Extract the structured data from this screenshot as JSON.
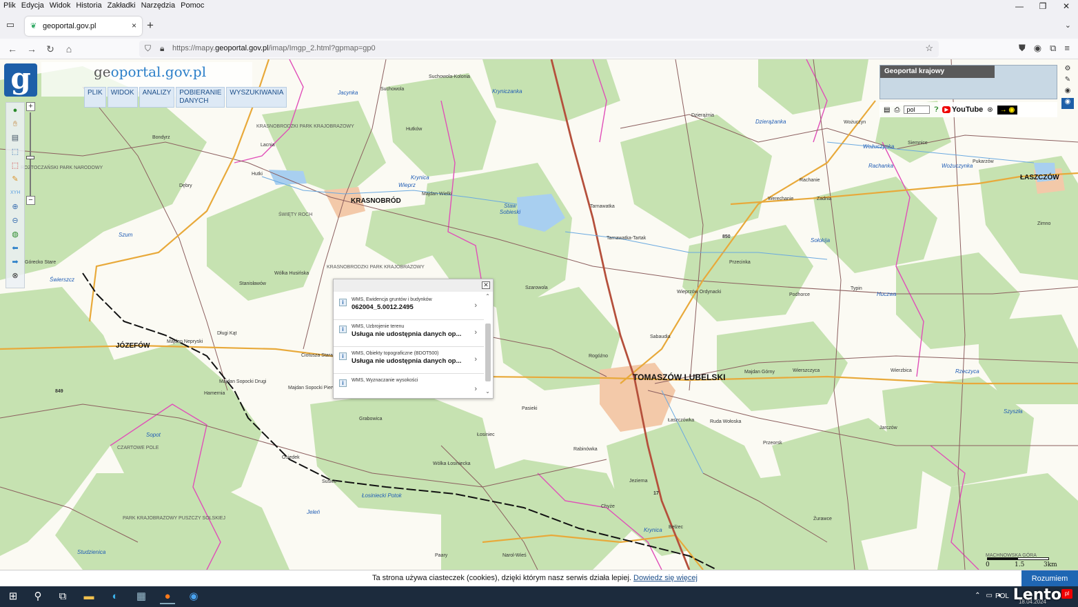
{
  "menubar": {
    "items": [
      "Plik",
      "Edycja",
      "Widok",
      "Historia",
      "Zakładki",
      "Narzędzia",
      "Pomoc"
    ]
  },
  "window_controls": {
    "minimize": "—",
    "restore": "❐",
    "close": "✕"
  },
  "tab": {
    "title": "geoportal.gov.pl",
    "close": "×",
    "new_tab": "+"
  },
  "navbar": {
    "url_prefix": "https://mapy.",
    "url_domain": "geoportal.gov.pl",
    "url_path": "/imap/Imgp_2.html?gpmap=gp0"
  },
  "geoportal": {
    "logo_letter": "g",
    "title_g": "ge",
    "title_rest": "oportal.gov.pl",
    "menu": [
      "PLIK",
      "WIDOK",
      "ANALIZY",
      "POBIERANIE DANYCH",
      "WYSZUKIWANIA"
    ],
    "overview_title": "Geoportal krajowy",
    "lang_select": "pol",
    "youtube_label": "YouTube"
  },
  "map_labels": {
    "bigtowns": [
      "TOMASZÓW LUBELSKI"
    ],
    "towns": [
      "KRASNOBRÓD",
      "JÓZEFÓW",
      "ŁASZCZÓW"
    ],
    "places": [
      "Suchowola",
      "Suchowola-Kolonia",
      "Bondyrz",
      "Hutków",
      "Hutki",
      "Majdan Wielki",
      "Tarnawatka",
      "Tarnawatka-Tartak",
      "Szarowola",
      "Stanisławów",
      "Wólka Husińska",
      "Długi Kąt",
      "Ciotusza Stara",
      "Majdan Nepryski",
      "Majdan Sopocki Drugi",
      "Majdan Sopocki Pierwszy",
      "Hamernia",
      "Górecko Stare",
      "Pasieki",
      "Rogóźno",
      "Sabaudia",
      "Wieprzów Ordynacki",
      "Przecinka",
      "Majdan Górny",
      "Łaszczówka",
      "Ruda Wołoska",
      "Przeorsk",
      "Typin",
      "Podhorce",
      "Jarczów",
      "Rabinówka",
      "Łosiniec",
      "Wólka Łosiniecka",
      "Grabowica",
      "Osiedek",
      "Susiec",
      "Jezierna",
      "Bełżec",
      "Chyże",
      "Narol-Wieś",
      "Paary",
      "Żurawce",
      "Wierzbica",
      "Rachanie",
      "Werechanie",
      "Zadnia",
      "Dzierążnia",
      "Wożuczyn",
      "Siemnice",
      "Pukarzów",
      "Zimno",
      "Wierszczyca",
      "Lacnia",
      "Dębry"
    ],
    "rivers": [
      "Jacynka",
      "Wieprz",
      "Krynica",
      "Szum",
      "Świerszcz",
      "Sopot",
      "Jeleń",
      "Łosiniecki Potok",
      "Studzienica",
      "Kryniczanka",
      "Dzierążanka",
      "Wożuczynka",
      "Rachanka",
      "Wożuczynka",
      "Sołokija",
      "Huczwa",
      "Rzeczyca",
      "Szyszła",
      "Krynica"
    ],
    "lake": "Staw Sobieski",
    "areas": [
      "KRASNOBRODZKI PARK KRAJOBRAZOWY",
      "KRASNOBRODZKI PARK KRAJOBRAZOWY",
      "PARK KRAJOBRAZOWY PUSZCZY SOLSKIEJ",
      "ROZTOCZAŃSKI PARK NARODOWY",
      "ŚWIĘTY ROCH",
      "CZARTOWE POLE",
      "MACHNOWSKA GÓRA"
    ],
    "road_numbers": [
      "850",
      "849",
      "17"
    ]
  },
  "popup": {
    "rows": [
      {
        "source": "WMS, Ewidencja gruntów i budynków",
        "value": "062004_5.0012.2495"
      },
      {
        "source": "WMS, Uzbrojenie terenu",
        "value": "Usługa nie udostępnia danych op..."
      },
      {
        "source": "WMS, Obiekty topograficzne (BDOT500)",
        "value": "Usługa nie udostępnia danych op..."
      },
      {
        "source": "WMS, Wyznaczanie wysokości",
        "value": ""
      }
    ],
    "info_icon": "i",
    "chevron": "›"
  },
  "scale": {
    "labels": [
      "0",
      "1.5",
      "3km"
    ]
  },
  "cookie": {
    "text": "Ta strona używa ciasteczek (cookies), dzięki którym nasz serwis działa lepiej.",
    "link": "Dowiedz się więcej",
    "button": "Rozumiem"
  },
  "taskbar": {
    "lang": "POL",
    "date": "18.04.2024",
    "watermark": "Lento",
    "watermark_badge": "pl"
  },
  "colors": {
    "forest": "#c6e2b1",
    "field": "#fbfaf3",
    "road_main": "#b5503c",
    "road_regional": "#e8a93a",
    "road_local": "#8b5e5e",
    "boundary": "#e04fb8",
    "water": "#a8cff0",
    "brand_blue": "#1d5fa8"
  }
}
